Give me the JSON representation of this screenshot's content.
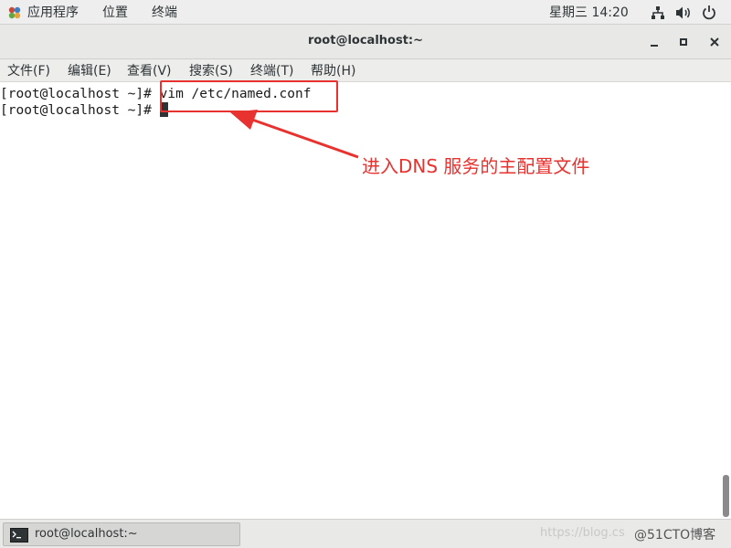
{
  "topbar": {
    "applications": "应用程序",
    "places": "位置",
    "terminal": "终端",
    "clock": "星期三 14:20"
  },
  "window": {
    "title": "root@localhost:~"
  },
  "menubar": {
    "file": "文件(F)",
    "edit": "编辑(E)",
    "view": "查看(V)",
    "search": "搜索(S)",
    "terminal": "终端(T)",
    "help": "帮助(H)"
  },
  "terminal": {
    "prompt": "[root@localhost ~]# ",
    "command": "vim /etc/named.conf"
  },
  "annotation": {
    "text": "进入DNS 服务的主配置文件",
    "color": "#e8322f"
  },
  "taskbar": {
    "task_label": "root@localhost:~",
    "watermark_url": "https://blog.cs",
    "watermark_brand": "@51CTO博客"
  }
}
